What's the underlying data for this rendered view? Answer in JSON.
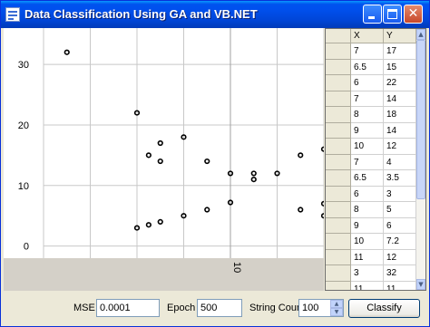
{
  "window": {
    "title": "Data Classification Using GA and VB.NET"
  },
  "controls": {
    "mse_label": "MSE",
    "mse_value": "0.0001",
    "epoch_label": "Epoch",
    "epoch_value": "500",
    "string_count_label": "String Count",
    "string_count_value": "100",
    "classify_label": "Classify"
  },
  "table": {
    "columns": [
      "X",
      "Y"
    ],
    "rows": [
      [
        "7",
        "17"
      ],
      [
        "6.5",
        "15"
      ],
      [
        "6",
        "22"
      ],
      [
        "7",
        "14"
      ],
      [
        "8",
        "18"
      ],
      [
        "9",
        "14"
      ],
      [
        "10",
        "12"
      ],
      [
        "7",
        "4"
      ],
      [
        "6.5",
        "3.5"
      ],
      [
        "6",
        "3"
      ],
      [
        "8",
        "5"
      ],
      [
        "9",
        "6"
      ],
      [
        "10",
        "7.2"
      ],
      [
        "11",
        "12"
      ],
      [
        "3",
        "32"
      ],
      [
        "11",
        "11"
      ]
    ]
  },
  "chart_data": {
    "type": "scatter",
    "xlim": [
      2,
      14
    ],
    "ylim": [
      -2,
      36
    ],
    "x_ticks": [
      10
    ],
    "y_ticks": [
      0,
      10,
      20,
      30
    ],
    "grid": true,
    "marker_color": "#000000",
    "series": [
      {
        "points": [
          [
            3,
            32
          ],
          [
            6,
            22
          ],
          [
            6.5,
            15
          ],
          [
            7,
            17
          ],
          [
            7,
            14
          ],
          [
            8,
            18
          ],
          [
            9,
            14
          ],
          [
            10,
            12
          ],
          [
            11,
            12
          ],
          [
            11,
            11
          ],
          [
            12,
            12
          ],
          [
            13,
            15
          ],
          [
            14,
            16
          ],
          [
            6,
            3
          ],
          [
            6.5,
            3.5
          ],
          [
            7,
            4
          ],
          [
            8,
            5
          ],
          [
            9,
            6
          ],
          [
            10,
            7.2
          ],
          [
            13,
            6
          ],
          [
            14,
            7
          ],
          [
            14,
            5
          ]
        ]
      }
    ]
  }
}
